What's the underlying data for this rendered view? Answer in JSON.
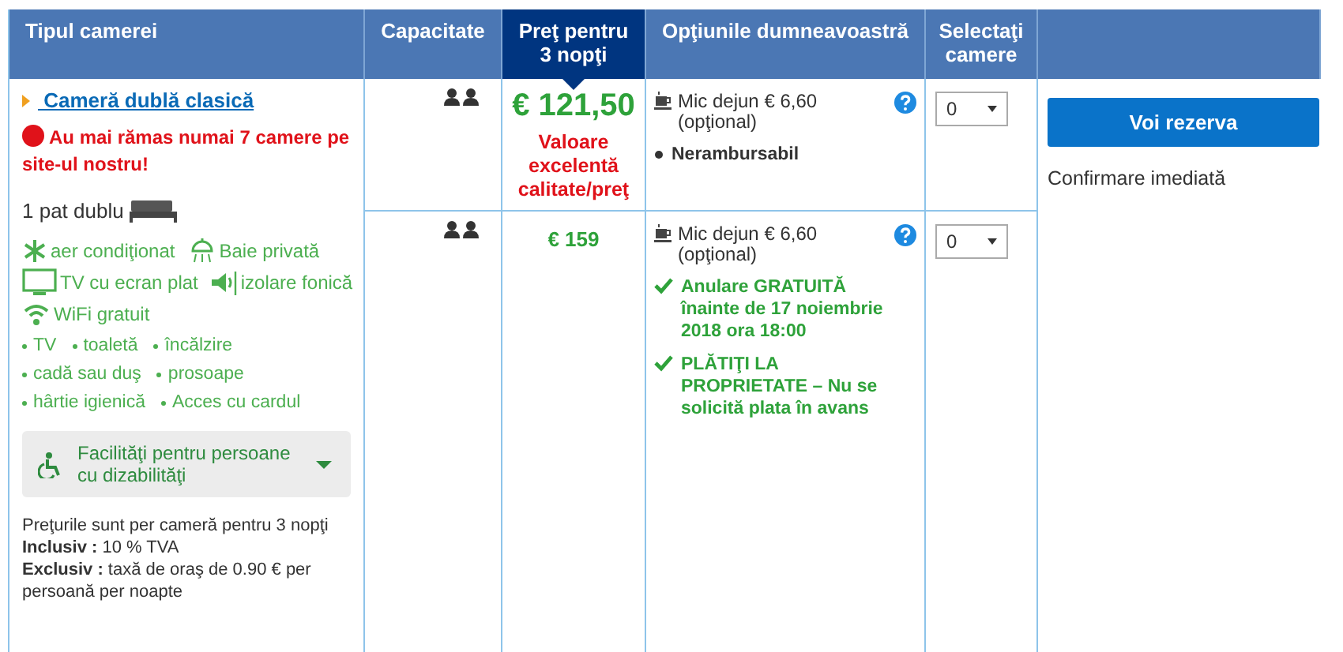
{
  "columns": [
    {
      "label": "Tipul camerei",
      "selected": false
    },
    {
      "label": "Capacitate",
      "selected": false
    },
    {
      "label": "Preţ pentru 3 nopţi",
      "selected": true
    },
    {
      "label": "Opţiunile dumneavoastră",
      "selected": false
    },
    {
      "label": "Selectaţi camere",
      "selected": false
    },
    {
      "selected": false
    }
  ],
  "room": {
    "name": "Cameră dublă clasică",
    "alert": "Au mai rămas numai 7 camere pe site-ul nostru!",
    "bed": "1 pat dublu",
    "facilities": [
      {
        "kind": "snowflake",
        "label": "aer condiţionat"
      },
      {
        "kind": "shower",
        "label": "Baie privată"
      },
      {
        "kind": "tv",
        "label": "TV cu ecran plat"
      },
      {
        "kind": "speaker",
        "label": "izolare fonică"
      },
      {
        "kind": "wifi",
        "label": "WiFi gratuit"
      }
    ],
    "amenities": [
      [
        "TV",
        "toaletă",
        "încălzire"
      ],
      [
        "cadă sau duş",
        "prosoape"
      ],
      [
        "hârtie igienică",
        "Acces cu cardul"
      ]
    ],
    "accessibility": {
      "label": "Facilităţi pentru persoane cu dizabilităţi",
      "expanded": false
    },
    "notes": [
      "Preţurile sunt per cameră pentru 3 nopţi",
      "**Inclusiv :** 10 % TVA",
      "**Exclusiv :** taxă de oraş de 0.90 € per persoană per noapte"
    ]
  },
  "offers": [
    {
      "price": "€ 121,50",
      "highlight": true,
      "price_note": "Valoare excelentă calitate/preţ",
      "meal": "Mic dejun € 6,60 (opţional)",
      "conditions": [
        {
          "kind": "bullet",
          "text": "Nerambursabil"
        }
      ],
      "quantity": "0"
    },
    {
      "price": "€ 159",
      "highlight": false,
      "meal": "Mic dejun € 6,60 (opţional)",
      "conditions": [
        {
          "kind": "check",
          "text": "Anulare GRATUITĂ înainte de 17 noiembrie 2018 ora 18:00"
        },
        {
          "kind": "check",
          "text": "PLĂTIŢI LA PROPRIETATE – Nu se solicită plata în avans"
        }
      ],
      "quantity": "0"
    }
  ],
  "action": {
    "button": "Voi rezerva",
    "note": "Confirmare imediată"
  }
}
